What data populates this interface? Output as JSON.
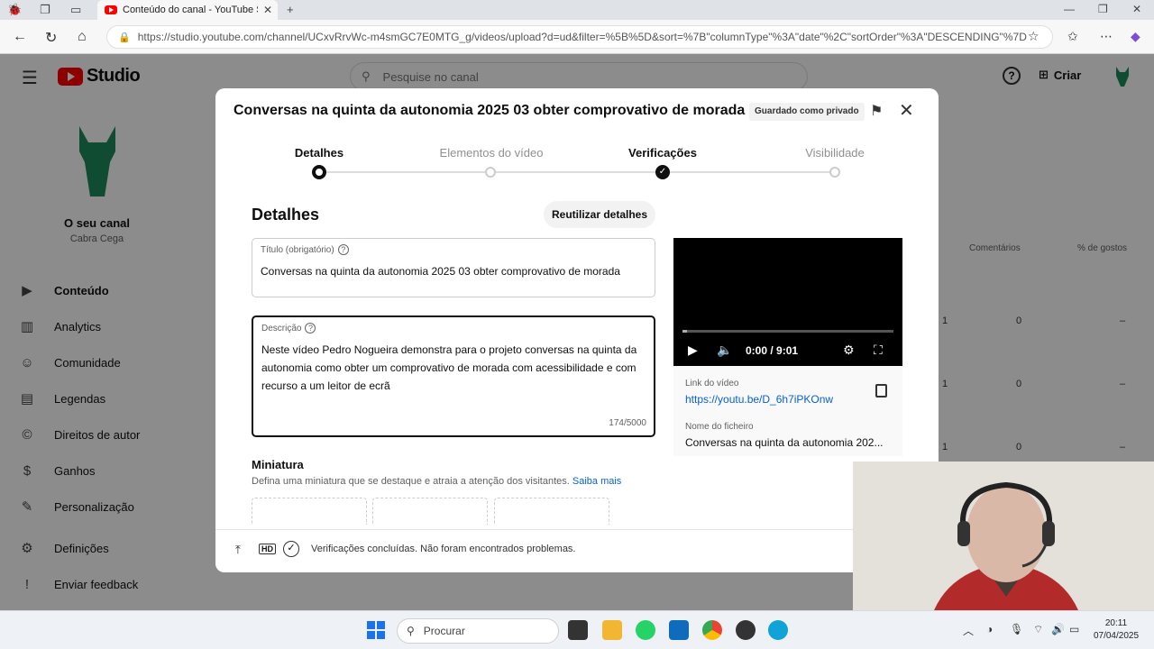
{
  "browser": {
    "tab_title": "Conteúdo do canal - YouTube Stu",
    "url": "https://studio.youtube.com/channel/UCxvRrvWc-m4smGC7E0MTG_g/videos/upload?d=ud&filter=%5B%5D&sort=%7B\"columnType\"%3A\"date\"%2C\"sortOrder\"%3A\"DESCENDING\"%7D"
  },
  "studio": {
    "logo_text": "Studio",
    "search_placeholder": "Pesquise no canal",
    "create_label": "Criar",
    "channel_name": "O seu canal",
    "channel_handle": "Cabra Cega",
    "sidebar_items": [
      {
        "label": "Conteúdo",
        "icon": "content-icon"
      },
      {
        "label": "Analytics",
        "icon": "analytics-icon"
      },
      {
        "label": "Comunidade",
        "icon": "community-icon"
      },
      {
        "label": "Legendas",
        "icon": "subtitles-icon"
      },
      {
        "label": "Direitos de autor",
        "icon": "copyright-icon"
      },
      {
        "label": "Ganhos",
        "icon": "earn-icon"
      },
      {
        "label": "Personalização",
        "icon": "customization-icon"
      },
      {
        "label": "Definições",
        "icon": "settings-icon"
      },
      {
        "label": "Enviar feedback",
        "icon": "feedback-icon"
      }
    ],
    "table_headers": [
      "Comentários",
      "% de gostos"
    ],
    "table_rows": [
      {
        "views": "1",
        "comments": "0",
        "likes": "–"
      },
      {
        "views": "1",
        "comments": "0",
        "likes": "–"
      },
      {
        "views": "1",
        "comments": "0",
        "likes": "–"
      }
    ]
  },
  "dialog": {
    "title": "Conversas na quinta da autonomia 2025 03 obter comprovativo de morada",
    "saved_badge": "Guardado como privado",
    "steps": [
      {
        "label": "Detalhes",
        "state": "current"
      },
      {
        "label": "Elementos do vídeo",
        "state": "pending"
      },
      {
        "label": "Verificações",
        "state": "done"
      },
      {
        "label": "Visibilidade",
        "state": "pending"
      }
    ],
    "section_title": "Detalhes",
    "reuse_button": "Reutilizar detalhes",
    "title_field": {
      "label": "Título (obrigatório)",
      "value": "Conversas na quinta da autonomia 2025 03 obter comprovativo de morada"
    },
    "description_field": {
      "label": "Descrição",
      "value": "Neste vídeo Pedro Nogueira demonstra para o projeto conversas na quinta da autonomia como obter um comprovativo de morada com acessibilidade e com recurso a um leitor de ecrã",
      "counter": "174/5000"
    },
    "thumbnail": {
      "title": "Miniatura",
      "description": "Defina uma miniatura que se destaque e atraia a atenção dos visitantes.",
      "learn_more": "Saiba mais"
    },
    "video": {
      "time": "0:00 / 9:01",
      "progress": 0.0,
      "link_label": "Link do vídeo",
      "link": "https://youtu.be/D_6h7iPKOnw",
      "filename_label": "Nome do ficheiro",
      "filename": "Conversas na quinta da autonomia 202..."
    },
    "footer_status": "Verificações concluídas. Não foram encontrados problemas."
  },
  "taskbar": {
    "search_label": "Procurar",
    "time": "20:11",
    "date": "07/04/2025"
  },
  "colors": {
    "youtube_red": "#ff0000",
    "link_blue": "#065fd4",
    "channel_green": "#1e8a5a"
  }
}
